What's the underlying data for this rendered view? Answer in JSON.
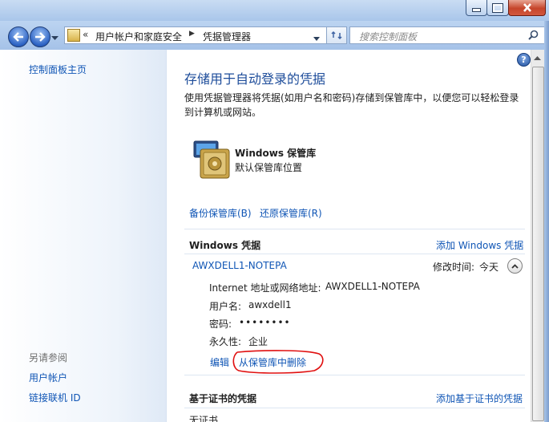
{
  "nav": {
    "address_path_1": "用户帐户和家庭安全",
    "address_path_2": "凭据管理器",
    "address_prefix": "«",
    "search_placeholder": "搜索控制面板"
  },
  "sidebar": {
    "home_link": "控制面板主页",
    "see_also_title": "另请参阅",
    "links": [
      "用户帐户",
      "链接联机 ID"
    ]
  },
  "main": {
    "title": "存储用于自动登录的凭据",
    "description": "使用凭据管理器将凭据(如用户名和密码)存储到保管库中，以便您可以轻松登录到计算机或网站。",
    "vault": {
      "title": "Windows 保管库",
      "subtitle": "默认保管库位置"
    },
    "backup_link": "备份保管库(B)",
    "restore_link": "还原保管库(R)",
    "windows_credentials": {
      "title": "Windows 凭据",
      "add_link": "添加 Windows 凭据",
      "entry": {
        "name": "AWXDELL1-NOTEPA",
        "modified_label": "修改时间:",
        "modified_value": "今天",
        "fields": [
          {
            "label": "Internet 地址或网络地址:",
            "value": "AWXDELL1-NOTEPA"
          },
          {
            "label": "用户名:",
            "value": "awxdell1"
          },
          {
            "label": "密码:",
            "value": "••••••••"
          },
          {
            "label": "永久性:",
            "value": "企业"
          }
        ],
        "edit_link": "编辑",
        "remove_link": "从保管库中删除"
      }
    },
    "cert_credentials": {
      "title": "基于证书的凭据",
      "add_link": "添加基于证书的凭据",
      "empty_text": "无证书"
    }
  },
  "colors": {
    "link": "#0f55b5",
    "title": "#1d4c9a",
    "highlight_circle": "#e01010"
  }
}
